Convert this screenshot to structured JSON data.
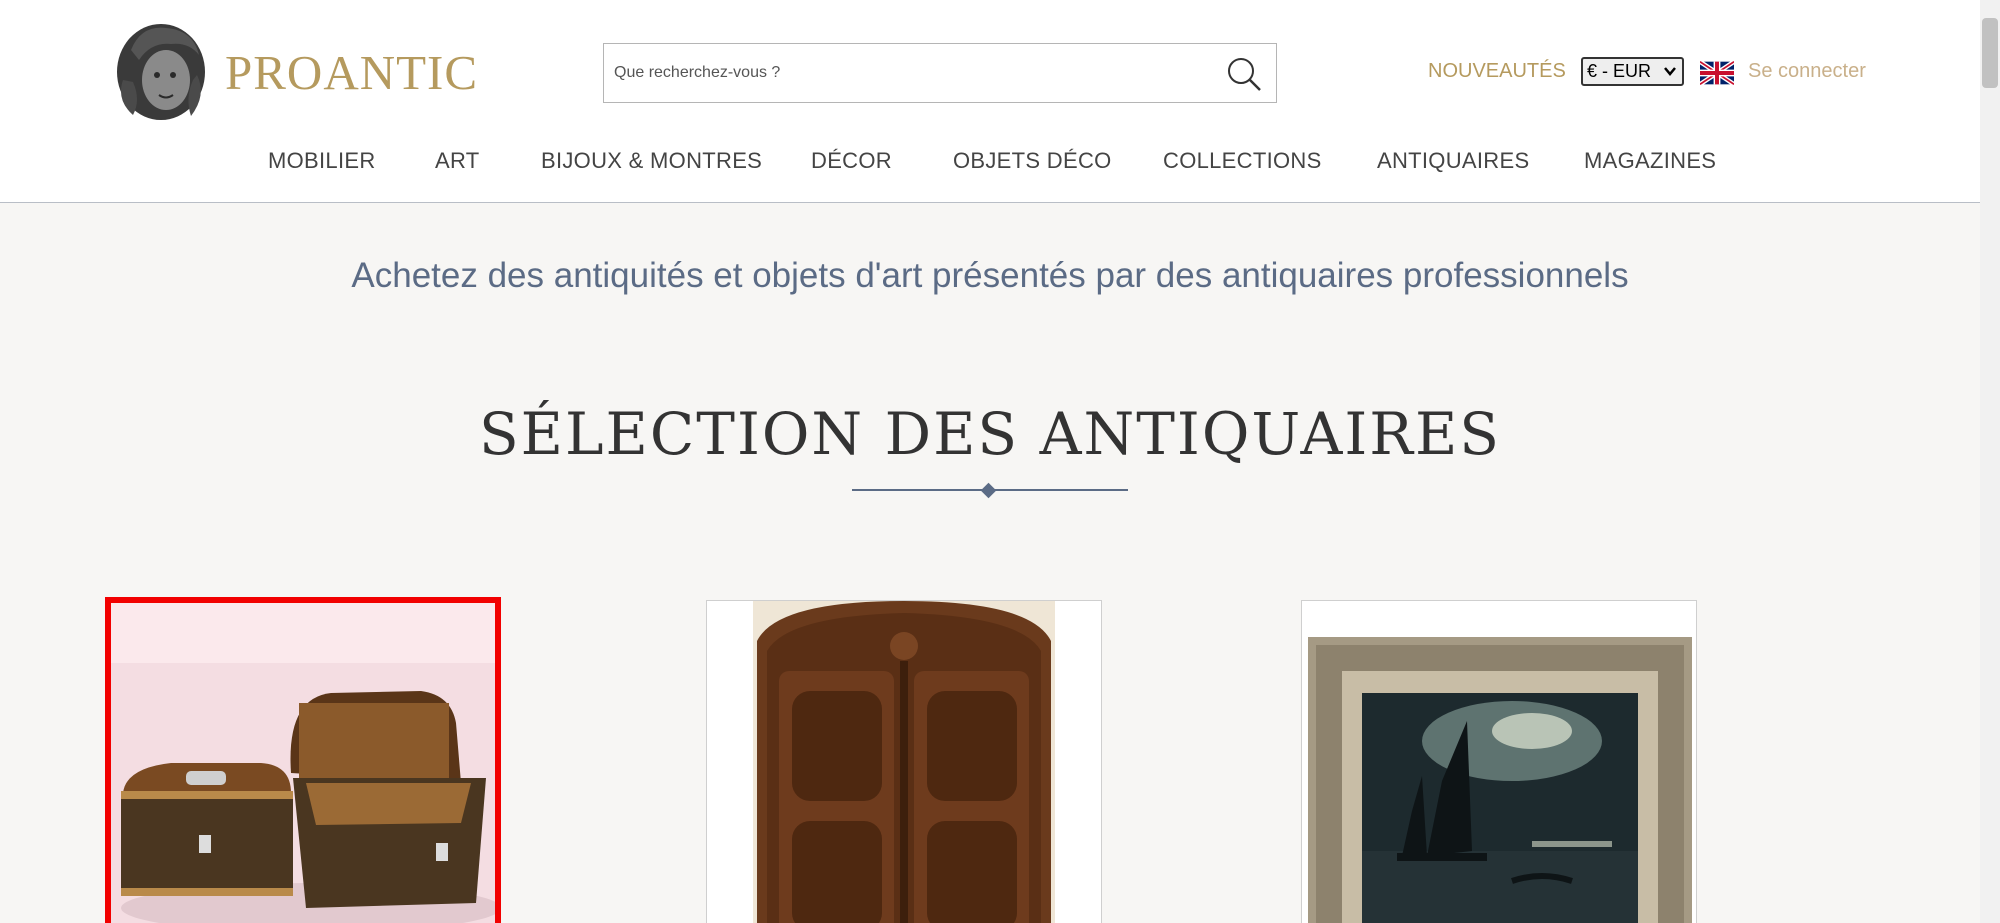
{
  "header": {
    "logo_text": "PROANTIC",
    "search_placeholder": "Que recherchez-vous ?",
    "nouveautes": "NOUVEAUTÉS",
    "currency": "€ - EUR",
    "login": "Se connecter"
  },
  "nav": {
    "items": [
      {
        "label": "MOBILIER"
      },
      {
        "label": "ART"
      },
      {
        "label": "BIJOUX & MONTRES"
      },
      {
        "label": "DÉCOR"
      },
      {
        "label": "OBJETS DÉCO"
      },
      {
        "label": "COLLECTIONS"
      },
      {
        "label": "ANTIQUAIRES"
      },
      {
        "label": "MAGAZINES"
      }
    ]
  },
  "main": {
    "tagline": "Achetez des antiquités et objets d'art présentés par des antiquaires professionnels",
    "section_title": "SÉLECTION DES ANTIQUAIRES"
  },
  "colors": {
    "brand_gold": "#b59a5e",
    "accent_blue": "#5b6b85",
    "selection_red": "#f20000"
  },
  "icons": [
    "logo-head-icon",
    "search-icon",
    "uk-flag-icon",
    "chevron-down-icon"
  ]
}
